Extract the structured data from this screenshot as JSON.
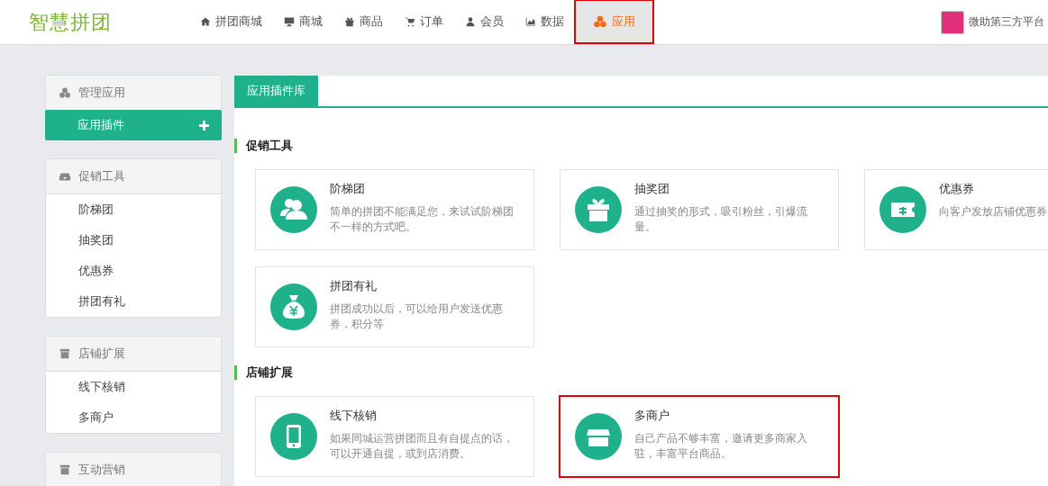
{
  "header": {
    "logo": "智慧拼团",
    "nav": [
      {
        "label": "拼团商城",
        "selected": false,
        "highlighted": false
      },
      {
        "label": "商城",
        "selected": false,
        "highlighted": false
      },
      {
        "label": "商品",
        "selected": false,
        "highlighted": false
      },
      {
        "label": "订单",
        "selected": false,
        "highlighted": false
      },
      {
        "label": "会员",
        "selected": false,
        "highlighted": false
      },
      {
        "label": "数据",
        "selected": false,
        "highlighted": false
      },
      {
        "label": "应用",
        "selected": true,
        "highlighted": true
      }
    ],
    "account": {
      "name": "微助第三方平台"
    }
  },
  "sidebar": {
    "groups": [
      {
        "title": "管理应用",
        "items": [
          {
            "label": "应用插件",
            "selected": true
          }
        ]
      },
      {
        "title": "促销工具",
        "items": [
          {
            "label": "阶梯团",
            "selected": false
          },
          {
            "label": "抽奖团",
            "selected": false
          },
          {
            "label": "优惠券",
            "selected": false
          },
          {
            "label": "拼团有礼",
            "selected": false
          }
        ]
      },
      {
        "title": "店铺扩展",
        "items": [
          {
            "label": "线下核销",
            "selected": false
          },
          {
            "label": "多商户",
            "selected": false
          }
        ]
      },
      {
        "title": "互动营销"
      }
    ]
  },
  "main": {
    "tabs": [
      {
        "label": "应用插件库",
        "selected": true
      }
    ],
    "sections": [
      {
        "title": "促销工具",
        "cards": [
          {
            "title": "阶梯团",
            "description": "简单的拼团不能满足您，来试试阶梯团不一样的方式吧。",
            "highlighted": false
          },
          {
            "title": "抽奖团",
            "description": "通过抽奖的形式，吸引粉丝，引爆流量。",
            "highlighted": false
          },
          {
            "title": "优惠券",
            "description": "向客户发放店铺优惠券",
            "highlighted": false
          },
          {
            "title": "拼团有礼",
            "description": "拼团成功以后，可以给用户发送优惠券，积分等",
            "highlighted": false
          }
        ]
      },
      {
        "title": "店铺扩展",
        "cards": [
          {
            "title": "线下核销",
            "description": "如果同城运营拼团而且有自提点的话，可以开通自提，或到店消费。",
            "highlighted": false
          },
          {
            "title": "多商户",
            "description": "自己产品不够丰富，邀请更多商家入驻，丰富平台商品。",
            "highlighted": true
          }
        ]
      }
    ]
  }
}
